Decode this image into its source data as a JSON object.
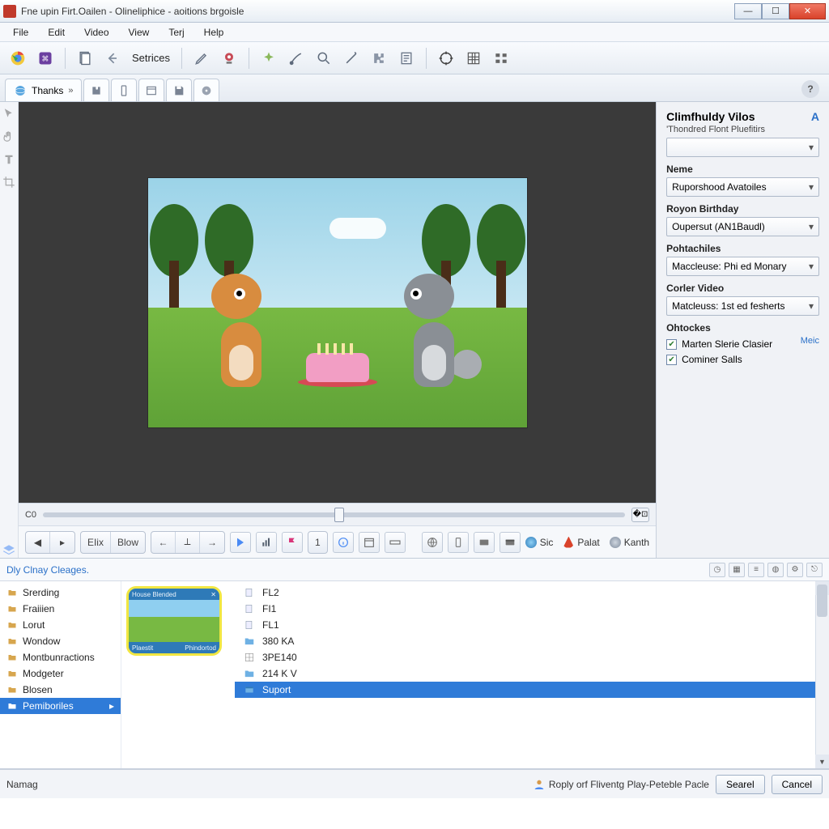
{
  "titlebar": {
    "text": "Fne upin Firt.Oailen - Olineliphice - aoitions brgoisle"
  },
  "menu": {
    "file": "File",
    "edit": "Edit",
    "video": "Video",
    "view": "View",
    "terj": "Terj",
    "help": "Help"
  },
  "toolbar": {
    "settings_label": "Setrices"
  },
  "tabs": {
    "main_label": "Thanks",
    "main_close": "»"
  },
  "slider": {
    "timecode": "C0"
  },
  "transport": {
    "elix": "EIix",
    "blow": "Blow",
    "one": "1",
    "link_sic": "Sic",
    "link_palat": "Palat",
    "link_kanth": "Kanth"
  },
  "panel": {
    "title": "Climfhuldy Vilos",
    "subtitle": "'Thondred Flont Pluefitirs",
    "search_value": "",
    "name_label": "Neme",
    "name_value": "Ruporshood Avatoiles",
    "royon_label": "Royon Birthday",
    "royon_value": "Oupersut (AN1Baudl)",
    "pol_label": "Pohtachiles",
    "pol_value": "Maccleuse: Phi ed Monary",
    "corler_label": "Corler Video",
    "corler_value": "Matcleuss: 1st ed fesherts",
    "oht_label": "Ohtockes",
    "oht_more": "Meic",
    "check1": "Marten Slerie Clasier",
    "check2": "Cominer Salls"
  },
  "browser": {
    "crumb": "Dly Clnay Cleages.",
    "folders": [
      "Srerding",
      "Fraiiien",
      "Lorut",
      "Wondow",
      "Montbunractions",
      "Modgeter",
      "Blosen",
      "Pemiboriles"
    ],
    "folders_selected_index": 7,
    "thumb_top": "House Blended",
    "thumb_bl": "Plaestit",
    "thumb_br": "Phindortod",
    "files": [
      {
        "label": "FL2",
        "icon": "doc"
      },
      {
        "label": "FI1",
        "icon": "doc"
      },
      {
        "label": "FL1",
        "icon": "doc"
      },
      {
        "label": "380 KA",
        "icon": "folder"
      },
      {
        "label": "3PE140",
        "icon": "grid"
      },
      {
        "label": "214 K V",
        "icon": "folder"
      },
      {
        "label": "Suport",
        "icon": "app"
      }
    ],
    "files_selected_index": 6
  },
  "status": {
    "msg": "Namag",
    "hint": "Roply orf Fliventg Play-Peteble Pacle",
    "search": "Searel",
    "cancel": "Cancel"
  }
}
